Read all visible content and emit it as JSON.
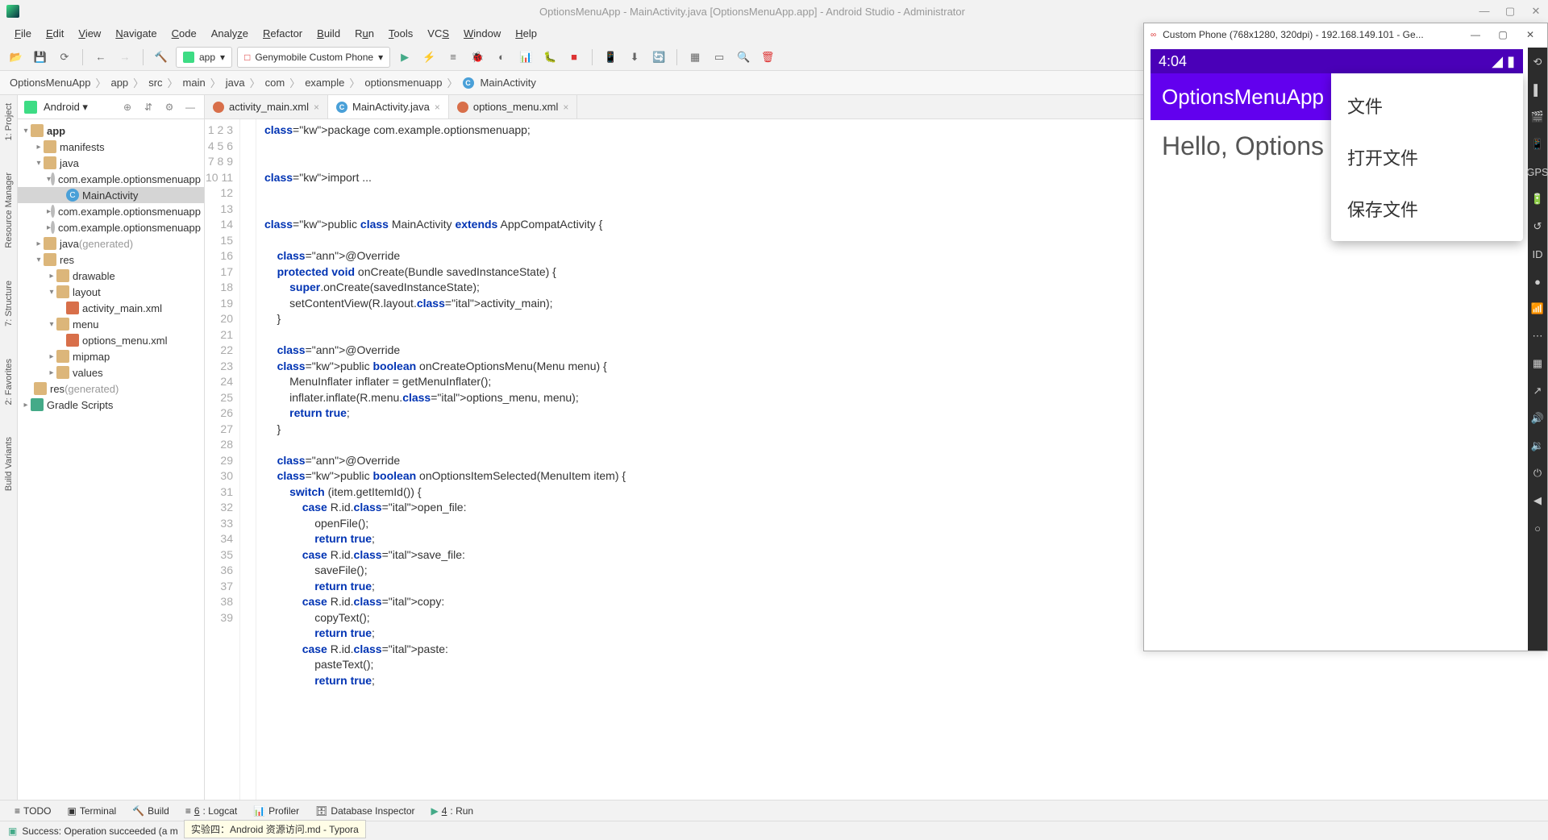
{
  "window": {
    "title": "OptionsMenuApp - MainActivity.java [OptionsMenuApp.app] - Android Studio - Administrator"
  },
  "menubar": [
    "File",
    "Edit",
    "View",
    "Navigate",
    "Code",
    "Analyze",
    "Refactor",
    "Build",
    "Run",
    "Tools",
    "VCS",
    "Window",
    "Help"
  ],
  "toolbar": {
    "config": "app",
    "device": "Genymobile Custom Phone"
  },
  "breadcrumb": [
    "OptionsMenuApp",
    "app",
    "src",
    "main",
    "java",
    "com",
    "example",
    "optionsmenuapp",
    "MainActivity"
  ],
  "project": {
    "mode": "Android",
    "tree": [
      "app",
      "manifests",
      "java",
      "com.example.optionsmenuapp",
      "MainActivity",
      "com.example.optionsmenuapp",
      "com.example.optionsmenuapp",
      "java (generated)",
      "res",
      "drawable",
      "layout",
      "activity_main.xml",
      "menu",
      "options_menu.xml",
      "mipmap",
      "values",
      "res (generated)",
      "Gradle Scripts"
    ]
  },
  "editor": {
    "tabs": [
      {
        "name": "activity_main.xml",
        "type": "xml",
        "active": false
      },
      {
        "name": "MainActivity.java",
        "type": "java",
        "active": true
      },
      {
        "name": "options_menu.xml",
        "type": "xml",
        "active": false
      }
    ],
    "lines_start": 1,
    "lines_end": 39,
    "code_text": "package com.example.optionsmenuapp;\n\n\nimport ...\n\n\npublic class MainActivity extends AppCompatActivity {\n\n    @Override\n    protected void onCreate(Bundle savedInstanceState) {\n        super.onCreate(savedInstanceState);\n        setContentView(R.layout.activity_main);\n    }\n\n    @Override\n    public boolean onCreateOptionsMenu(Menu menu) {\n        MenuInflater inflater = getMenuInflater();\n        inflater.inflate(R.menu.options_menu, menu);\n        return true;\n    }\n\n    @Override\n    public boolean onOptionsItemSelected(MenuItem item) {\n        switch (item.getItemId()) {\n            case R.id.open_file:\n                openFile();\n                return true;\n            case R.id.save_file:\n                saveFile();\n                return true;\n            case R.id.copy:\n                copyText();\n                return true;\n            case R.id.paste:\n                pasteText();\n                return true;"
  },
  "emulator": {
    "title": "Custom Phone (768x1280, 320dpi) - 192.168.149.101 - Ge...",
    "time": "4:04",
    "app_title": "OptionsMenuApp",
    "body": "Hello, Options Me",
    "menu": [
      "文件",
      "打开文件",
      "保存文件"
    ]
  },
  "bottom_tools": [
    "TODO",
    "Terminal",
    "Build",
    "6: Logcat",
    "Profiler",
    "Database Inspector",
    "4: Run"
  ],
  "status": {
    "message": "Success: Operation succeeded (a m",
    "tooltip": "实验四：Android 资源访问.md - Typora"
  },
  "left_rail": [
    "1: Project",
    "Resource Manager",
    "7: Structure",
    "2: Favorites",
    "Build Variants"
  ]
}
